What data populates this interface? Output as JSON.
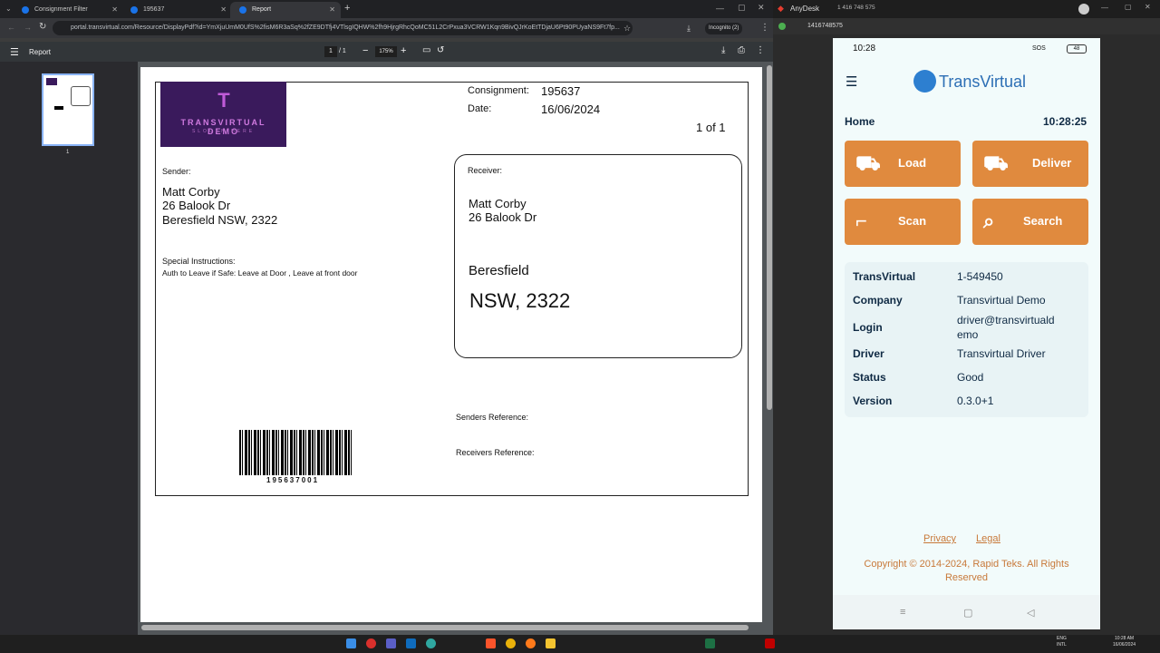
{
  "browser": {
    "tabs": [
      {
        "label": "Consignment Filter"
      },
      {
        "label": "195637"
      },
      {
        "label": "Report"
      }
    ],
    "url": "portal.transvirtual.com/Resource/DisplayPdf?id=YmXjuUmM0UfS%2fisM6R3aSq%2fZE9DTfj4VTlsgIQHW%2fh9HjrgRhcQoMC51L2CrPxua3VCRW1Kqn9BivQJrKoEtTDjaU6Pt90PUyaNS9Ft7fp...",
    "incognito": "Incognito (2)"
  },
  "pdf": {
    "title": "Report",
    "page_current": "1",
    "page_total": "/ 1",
    "zoom": "175%",
    "thumb_label": "1"
  },
  "doc": {
    "logo_main": "TRANSVIRTUAL DEMO",
    "logo_sub": "SLOGAN HERE",
    "consignment_label": "Consignment:",
    "consignment_value": "195637",
    "date_label": "Date:",
    "date_value": "16/06/2024",
    "page_of": "1 of 1",
    "sender_label": "Sender:",
    "sender_name": "Matt Corby",
    "sender_street": "26 Balook Dr",
    "sender_city": "Beresfield NSW, 2322",
    "special_label": "Special Instructions:",
    "special_text": "Auth to Leave if Safe: Leave at Door , Leave at front door",
    "receiver_label": "Receiver:",
    "receiver_name": "Matt Corby",
    "receiver_street": "26 Balook Dr",
    "receiver_suburb": "Beresfield",
    "receiver_state": "NSW, 2322",
    "senders_ref_label": "Senders Reference:",
    "receivers_ref_label": "Receivers Reference:",
    "barcode_number": "195637001"
  },
  "anydesk": {
    "app": "AnyDesk",
    "session_id": "1 416 748 575",
    "address": "1416748575"
  },
  "phone": {
    "time": "10:28",
    "status_icons": "SOS",
    "battery": "48",
    "brand": "TransVirtual",
    "page": "Home",
    "clock": "10:28:25",
    "buttons": {
      "load": "Load",
      "deliver": "Deliver",
      "scan": "Scan",
      "search": "Search"
    },
    "info": [
      {
        "k": "TransVirtual",
        "v": "1-549450"
      },
      {
        "k": "Company",
        "v": "Transvirtual Demo"
      },
      {
        "k": "Login",
        "v": "driver@transvirtuald",
        "v2": "emo"
      },
      {
        "k": "Driver",
        "v": "Transvirtual Driver"
      },
      {
        "k": "Status",
        "v": "Good"
      },
      {
        "k": "Version",
        "v": "0.3.0+1"
      }
    ],
    "privacy": "Privacy",
    "legal": "Legal",
    "copyright1": "Copyright © 2014-2024, Rapid Teks. All Rights",
    "copyright2": "Reserved"
  },
  "taskbar": {
    "lang1": "ENG",
    "lang2": "INTL",
    "time": "10:28 AM",
    "date": "16/06/2024"
  },
  "colors": {
    "accent": "#e08a3e",
    "navy": "#0f2a44",
    "logo_bg": "#3a1a5c"
  }
}
